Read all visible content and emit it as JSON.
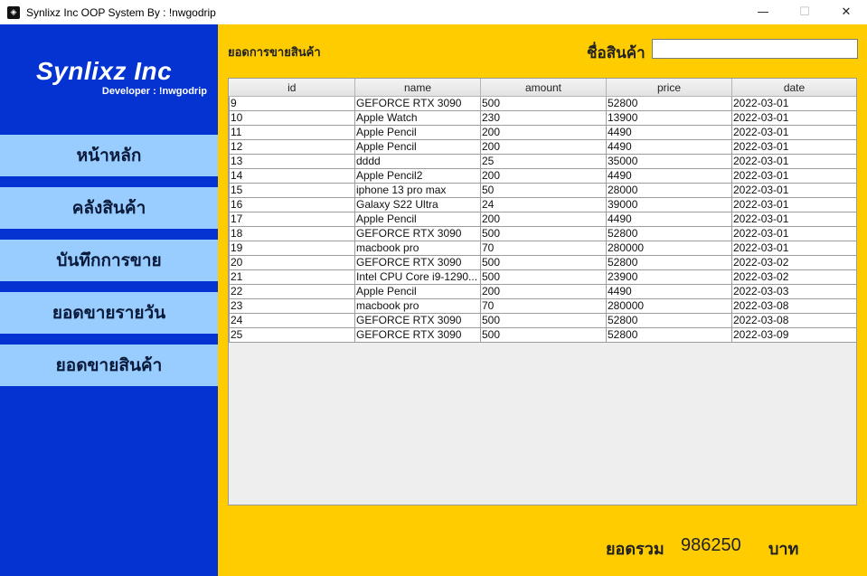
{
  "window": {
    "title": "Synlixz Inc OOP System By : !nwgodrip",
    "minimize": "—",
    "maximize": "☐",
    "close": "✕",
    "app_icon": "◈"
  },
  "sidebar": {
    "brand": "Synlixz Inc",
    "developer": "Developer : !nwgodrip",
    "items": [
      {
        "label": "หน้าหลัก"
      },
      {
        "label": "คลังสินค้า"
      },
      {
        "label": "บันทึกการขาย"
      },
      {
        "label": "ยอดขายรายวัน"
      },
      {
        "label": "ยอดขายสินค้า"
      }
    ]
  },
  "main": {
    "heading": "ยอดการขายสินค้า",
    "search_label": "ชื่อสินค้า",
    "search_value": ""
  },
  "table": {
    "columns": [
      "id",
      "name",
      "amount",
      "price",
      "date"
    ],
    "rows": [
      [
        "9",
        "GEFORCE RTX 3090",
        "500",
        "52800",
        "2022-03-01"
      ],
      [
        "10",
        "Apple Watch",
        "230",
        "13900",
        "2022-03-01"
      ],
      [
        "11",
        "Apple Pencil",
        "200",
        "4490",
        "2022-03-01"
      ],
      [
        "12",
        "Apple Pencil",
        "200",
        "4490",
        "2022-03-01"
      ],
      [
        "13",
        "dddd",
        "25",
        "35000",
        "2022-03-01"
      ],
      [
        "14",
        "Apple Pencil2",
        "200",
        "4490",
        "2022-03-01"
      ],
      [
        "15",
        "iphone 13 pro max",
        "50",
        "28000",
        "2022-03-01"
      ],
      [
        "16",
        "Galaxy S22 Ultra",
        "24",
        "39000",
        "2022-03-01"
      ],
      [
        "17",
        "Apple Pencil",
        "200",
        "4490",
        "2022-03-01"
      ],
      [
        "18",
        "GEFORCE RTX 3090",
        "500",
        "52800",
        "2022-03-01"
      ],
      [
        "19",
        "macbook pro",
        "70",
        "280000",
        "2022-03-01"
      ],
      [
        "20",
        "GEFORCE RTX 3090",
        "500",
        "52800",
        "2022-03-02"
      ],
      [
        "21",
        "Intel CPU Core i9-1290...",
        "500",
        "23900",
        "2022-03-02"
      ],
      [
        "22",
        "Apple Pencil",
        "200",
        "4490",
        "2022-03-03"
      ],
      [
        "23",
        "macbook pro",
        "70",
        "280000",
        "2022-03-08"
      ],
      [
        "24",
        "GEFORCE RTX 3090",
        "500",
        "52800",
        "2022-03-08"
      ],
      [
        "25",
        "GEFORCE RTX 3090",
        "500",
        "52800",
        "2022-03-09"
      ]
    ]
  },
  "total": {
    "label": "ยอดรวม",
    "value": "986250",
    "unit": "บาท"
  },
  "colors": {
    "sidebar": "#0433d1",
    "nav_button": "#99ccff",
    "main_background": "#ffcc00"
  }
}
